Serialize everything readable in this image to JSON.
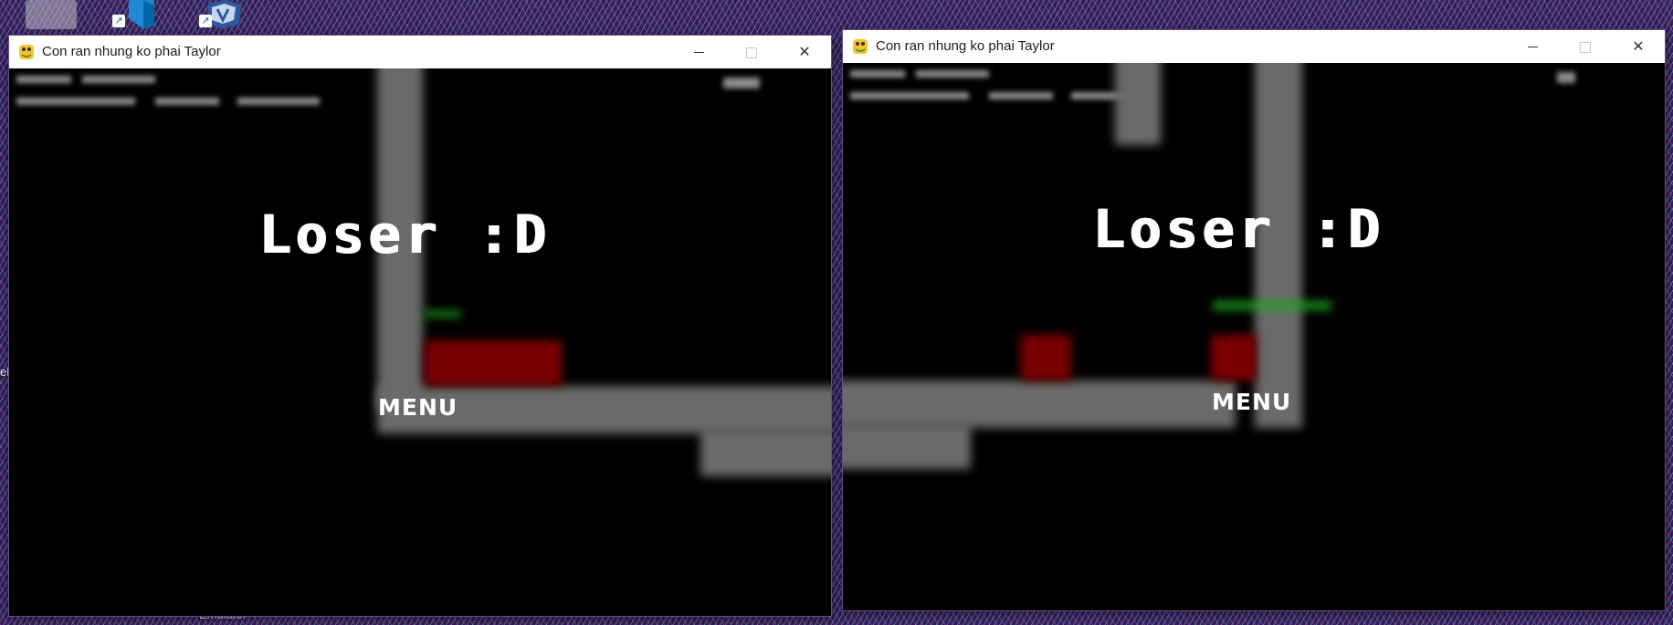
{
  "desktop": {
    "icons": [
      {
        "name": "blurred-app-icon"
      },
      {
        "name": "vscode-icon"
      },
      {
        "name": "virtualbox-icon"
      }
    ],
    "partial_label_bottom": "Emulator",
    "partial_label_left": "el"
  },
  "windows": [
    {
      "title": "Con ran nhung ko phai Taylor",
      "controls": {
        "minimize": "minimize",
        "maximize": "maximize",
        "close": "close"
      },
      "game": {
        "game_over_text": "Loser :D",
        "menu_label": "MENU"
      }
    },
    {
      "title": "Con ran nhung ko phai Taylor",
      "controls": {
        "minimize": "minimize",
        "maximize": "maximize",
        "close": "close"
      },
      "game": {
        "game_over_text": "Loser :D",
        "menu_label": "MENU"
      }
    }
  ],
  "colors": {
    "game_background": "#000000",
    "wall": "#6a6a6a",
    "food_red": "#7a0000",
    "snake_green": "#1da51d",
    "text": "#ffffff"
  }
}
